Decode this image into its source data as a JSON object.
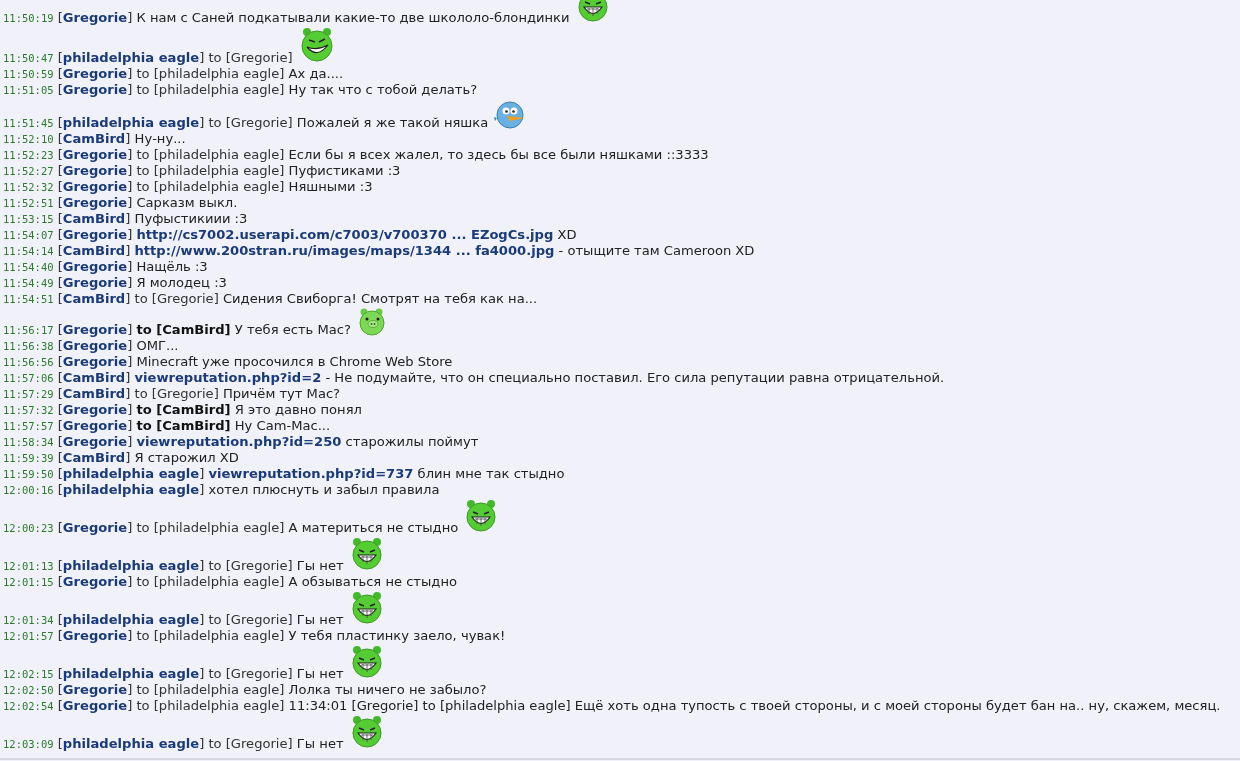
{
  "messages": [
    {
      "time": "11:50:19",
      "user": "[**Gregorie**]",
      "parts": [
        {
          "kind": "text",
          "text": "К нам с Саней подкатывали какие-то две школоло-блондинки"
        }
      ],
      "emoticon": {
        "kind": "laughing"
      }
    },
    {
      "time": "11:50:47",
      "user": "[**philadelphia eagle**]",
      "to": "to [Gregorie]",
      "private": false,
      "emoticon": {
        "kind": "grin"
      }
    },
    {
      "time": "11:50:59",
      "user": "[**Gregorie**]",
      "to": "to [philadelphia eagle]",
      "private": false,
      "parts": [
        {
          "kind": "text",
          "text": "Ах да...."
        }
      ]
    },
    {
      "time": "11:51:05",
      "user": "[**Gregorie**]",
      "to": "to [philadelphia eagle]",
      "private": false,
      "parts": [
        {
          "kind": "text",
          "text": "Ну так что с тобой делать?"
        }
      ]
    },
    {
      "time": "11:51:45",
      "user": "[**philadelphia eagle**]",
      "to": "to [Gregorie]",
      "private": false,
      "parts": [
        {
          "kind": "text",
          "text": "Пожалей я же такой няшка"
        }
      ],
      "emoticon": {
        "kind": "bird"
      }
    },
    {
      "time": "11:52:10",
      "user": "[**CamBird**]",
      "parts": [
        {
          "kind": "text",
          "text": "Ну-ну..."
        }
      ]
    },
    {
      "time": "11:52:23",
      "user": "[**Gregorie**]",
      "to": "to [philadelphia eagle]",
      "private": false,
      "parts": [
        {
          "kind": "text",
          "text": "Если бы я всех жалел, то здесь бы все были няшками ::3333"
        }
      ]
    },
    {
      "time": "11:52:27",
      "user": "[**Gregorie**]",
      "to": "to [philadelphia eagle]",
      "private": false,
      "parts": [
        {
          "kind": "text",
          "text": "Пуфистиками :3"
        }
      ]
    },
    {
      "time": "11:52:32",
      "user": "[**Gregorie**]",
      "to": "to [philadelphia eagle]",
      "private": false,
      "parts": [
        {
          "kind": "text",
          "text": "Няшными :3"
        }
      ]
    },
    {
      "time": "11:52:51",
      "user": "[**Gregorie**]",
      "parts": [
        {
          "kind": "text",
          "text": "Сарказм выкл."
        }
      ]
    },
    {
      "time": "11:53:15",
      "user": "[**CamBird**]",
      "parts": [
        {
          "kind": "text",
          "text": "Пуфыстикиии :3"
        }
      ]
    },
    {
      "time": "11:54:07",
      "user": "[**Gregorie**]",
      "parts": [
        {
          "kind": "link",
          "text": "http://cs7002.userapi.com/c7003/v700370 ... EZogCs.jpg"
        },
        {
          "kind": "text",
          "text": " XD"
        }
      ]
    },
    {
      "time": "11:54:14",
      "user": "[**CamBird**]",
      "parts": [
        {
          "kind": "link",
          "text": "http://www.200stran.ru/images/maps/1344 ... fa4000.jpg"
        },
        {
          "kind": "text",
          "text": " - отыщите там Cameroon XD"
        }
      ]
    },
    {
      "time": "11:54:40",
      "user": "[**Gregorie**]",
      "parts": [
        {
          "kind": "text",
          "text": "Нащёль :3"
        }
      ]
    },
    {
      "time": "11:54:49",
      "user": "[**Gregorie**]",
      "parts": [
        {
          "kind": "text",
          "text": "Я молодец :3"
        }
      ]
    },
    {
      "time": "11:54:51",
      "user": "[**CamBird**]",
      "to": "to [Gregorie]",
      "private": false,
      "parts": [
        {
          "kind": "text",
          "text": "Сидения Свиборга! Смотрят на тебя как на..."
        }
      ]
    },
    {
      "time": "11:56:17",
      "user": "[**Gregorie**]",
      "to": "to [CamBird]",
      "private": true,
      "parts": [
        {
          "kind": "text",
          "text": "У тебя есть Mac?"
        }
      ],
      "emoticon": {
        "kind": "pig"
      }
    },
    {
      "time": "11:56:38",
      "user": "[**Gregorie**]",
      "parts": [
        {
          "kind": "text",
          "text": "ОМГ..."
        }
      ]
    },
    {
      "time": "11:56:56",
      "user": "[**Gregorie**]",
      "parts": [
        {
          "kind": "text",
          "text": "Minecraft уже просочился в Chrome Web Store"
        }
      ]
    },
    {
      "time": "11:57:06",
      "user": "[**CamBird**]",
      "parts": [
        {
          "kind": "link",
          "text": "viewreputation.php?id=2"
        },
        {
          "kind": "text",
          "text": " - Не подумайте, что он специально поставил. Его сила репутации равна отрицательной."
        }
      ]
    },
    {
      "time": "11:57:29",
      "user": "[**CamBird**]",
      "to": "to [Gregorie]",
      "private": false,
      "parts": [
        {
          "kind": "text",
          "text": "Причём тут Mac?"
        }
      ]
    },
    {
      "time": "11:57:32",
      "user": "[**Gregorie**]",
      "to": "to [CamBird]",
      "private": true,
      "parts": [
        {
          "kind": "text",
          "text": "Я это давно понял"
        }
      ]
    },
    {
      "time": "11:57:57",
      "user": "[**Gregorie**]",
      "to": "to [CamBird]",
      "private": true,
      "parts": [
        {
          "kind": "text",
          "text": "Ну Cam-Mac..."
        }
      ]
    },
    {
      "time": "11:58:34",
      "user": "[**Gregorie**]",
      "parts": [
        {
          "kind": "link",
          "text": "viewreputation.php?id=250"
        },
        {
          "kind": "text",
          "text": " старожилы поймут"
        }
      ]
    },
    {
      "time": "11:59:39",
      "user": "[**CamBird**]",
      "parts": [
        {
          "kind": "text",
          "text": "Я старожил XD"
        }
      ]
    },
    {
      "time": "11:59:50",
      "user": "[**philadelphia eagle**]",
      "parts": [
        {
          "kind": "link",
          "text": "viewreputation.php?id=737"
        },
        {
          "kind": "text",
          "text": " блин мне так стыдно"
        }
      ]
    },
    {
      "time": "12:00:16",
      "user": "[**philadelphia eagle**]",
      "parts": [
        {
          "kind": "text",
          "text": "хотел плюснуть и забыл правила"
        }
      ]
    },
    {
      "time": "12:00:23",
      "user": "[**Gregorie**]",
      "to": "to [philadelphia eagle]",
      "private": false,
      "parts": [
        {
          "kind": "text",
          "text": "А материться не стыдно"
        }
      ],
      "emoticon": {
        "kind": "laughing"
      }
    },
    {
      "time": "12:01:13",
      "user": "[**philadelphia eagle**]",
      "to": "to [Gregorie]",
      "private": false,
      "parts": [
        {
          "kind": "text",
          "text": "Гы нет"
        }
      ],
      "emoticon": {
        "kind": "laughing"
      }
    },
    {
      "time": "12:01:15",
      "user": "[**Gregorie**]",
      "to": "to [philadelphia eagle]",
      "private": false,
      "parts": [
        {
          "kind": "text",
          "text": "А обзываться не стыдно"
        }
      ]
    },
    {
      "time": "12:01:34",
      "user": "[**philadelphia eagle**]",
      "to": "to [Gregorie]",
      "private": false,
      "parts": [
        {
          "kind": "text",
          "text": "Гы нет"
        }
      ],
      "emoticon": {
        "kind": "laughing"
      }
    },
    {
      "time": "12:01:57",
      "user": "[**Gregorie**]",
      "to": "to [philadelphia eagle]",
      "private": false,
      "parts": [
        {
          "kind": "text",
          "text": "У тебя пластинку заело, чувак!"
        }
      ]
    },
    {
      "time": "12:02:15",
      "user": "[**philadelphia eagle**]",
      "to": "to [Gregorie]",
      "private": false,
      "parts": [
        {
          "kind": "text",
          "text": "Гы нет"
        }
      ],
      "emoticon": {
        "kind": "laughing"
      }
    },
    {
      "time": "12:02:50",
      "user": "[**Gregorie**]",
      "to": "to [philadelphia eagle]",
      "private": false,
      "parts": [
        {
          "kind": "text",
          "text": "Лолка ты ничего не забыло?"
        }
      ]
    },
    {
      "time": "12:02:54",
      "user": "[**Gregorie**]",
      "to": "to [philadelphia eagle]",
      "private": false,
      "parts": [
        {
          "kind": "text",
          "text": "11:34:01 [Gregorie] to [philadelphia eagle] Ещё хоть одна тупость с твоей стороны, и с моей стороны будет бан на.. ну, скажем, месяц."
        }
      ]
    },
    {
      "time": "12:03:09",
      "user": "[**philadelphia eagle**]",
      "to": "to [Gregorie]",
      "private": false,
      "parts": [
        {
          "kind": "text",
          "text": "Гы нет"
        }
      ],
      "emoticon": {
        "kind": "laughing"
      }
    }
  ]
}
